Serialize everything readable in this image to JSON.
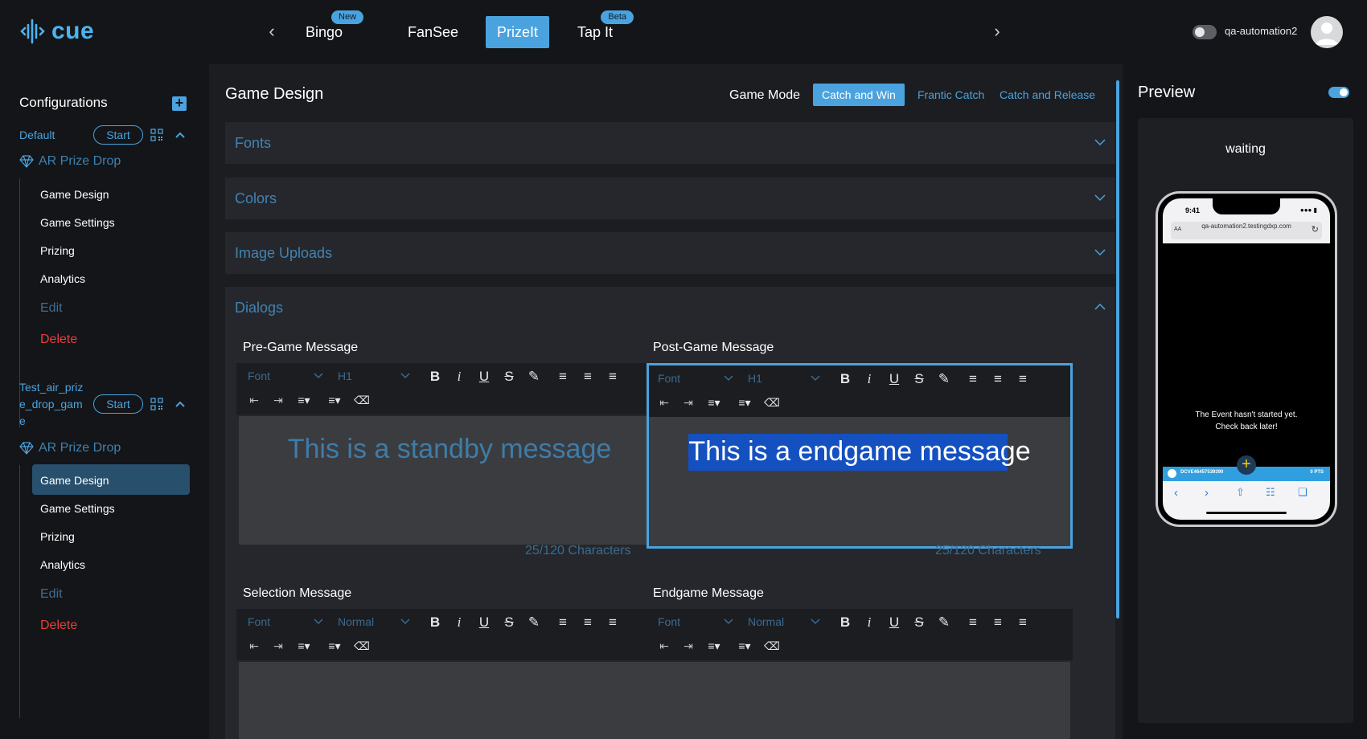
{
  "app": {
    "logo_text": "cue"
  },
  "topnav": {
    "tabs": [
      {
        "label": "Bingo",
        "badge": "New"
      },
      {
        "label": "FanSee",
        "badge": ""
      },
      {
        "label": "PrizeIt",
        "badge": ""
      },
      {
        "label": "Tap It",
        "badge": "Beta"
      }
    ],
    "active_tab": "PrizeIt",
    "username": "qa-automation2"
  },
  "sidebar": {
    "title": "Configurations",
    "configs": [
      {
        "name": "Default",
        "start_label": "Start",
        "game_type": "AR Prize Drop",
        "items": [
          "Game Design",
          "Game Settings",
          "Prizing",
          "Analytics"
        ],
        "edit_label": "Edit",
        "delete_label": "Delete"
      },
      {
        "name_lines": [
          "Test_air_priz",
          "e_drop_gam",
          "e"
        ],
        "start_label": "Start",
        "game_type": "AR Prize Drop",
        "items": [
          "Game Design",
          "Game Settings",
          "Prizing",
          "Analytics"
        ],
        "active_item": "Game Design",
        "edit_label": "Edit",
        "delete_label": "Delete"
      }
    ]
  },
  "main": {
    "title": "Game Design",
    "game_mode_label": "Game Mode",
    "game_modes": [
      "Catch and Win",
      "Frantic Catch",
      "Catch and Release"
    ],
    "active_mode": "Catch and Win",
    "sections": [
      "Fonts",
      "Colors",
      "Image Uploads",
      "Dialogs"
    ],
    "expanded_section": "Dialogs",
    "dialogs": {
      "pre_game": {
        "label": "Pre-Game Message",
        "font_placeholder": "Font",
        "size_value": "H1",
        "text": "This is a standby message",
        "char_count": "25/120 Characters"
      },
      "post_game": {
        "label": "Post-Game Message",
        "font_placeholder": "Font",
        "size_value": "H1",
        "text": "This is a endgame message",
        "char_count": "25/120 Characters"
      },
      "selection": {
        "label": "Selection Message",
        "font_placeholder": "Font",
        "size_value": "Normal"
      },
      "endgame": {
        "label": "Endgame Message",
        "font_placeholder": "Font",
        "size_value": "Normal"
      }
    }
  },
  "preview": {
    "title": "Preview",
    "toggle_on": true,
    "status": "waiting",
    "phone": {
      "time": "9:41",
      "url": "qa-automation2.testingdxp.com",
      "aa_label": "AA",
      "message": "The Event hasn't started yet. Check back later!",
      "bar_id": "DCVE46457539390",
      "bar_points": "0 PTS"
    }
  },
  "colors": {
    "accent": "#4aa3de",
    "delete": "#ef3b3b",
    "background": "#141518",
    "panel": "#25272c"
  }
}
